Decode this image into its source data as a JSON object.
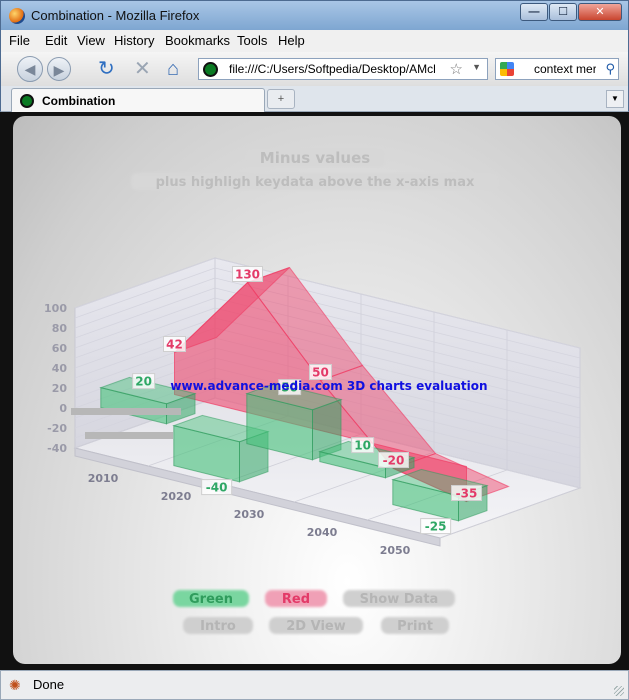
{
  "window": {
    "title": "Combination - Mozilla Firefox",
    "minimize": "—",
    "maximize": "☐",
    "close": "✕"
  },
  "menu": {
    "items": [
      "File",
      "Edit",
      "View",
      "History",
      "Bookmarks",
      "Tools",
      "Help"
    ]
  },
  "nav": {
    "url": "file:///C:/Users/Softpedia/Desktop/AMcl",
    "search_text": "context mer"
  },
  "tab": {
    "label": "Combination",
    "new_tab": "+"
  },
  "status": {
    "text": "Done"
  },
  "chart": {
    "title": "Minus values",
    "subtitle": "plus highligh keydata above the x-axis max",
    "watermark": "www.advance-media.com 3D charts evaluation",
    "buttons": {
      "green": "Green",
      "red": "Red",
      "show_data": "Show Data",
      "intro": "Intro",
      "view_2d": "2D View",
      "print": "Print"
    },
    "colors": {
      "green": "#44c27a",
      "red": "#f03c64",
      "watermark": "#1010e0"
    }
  },
  "chart_data": {
    "type": "bar",
    "categories": [
      "2010",
      "2020",
      "2030",
      "2040",
      "2050"
    ],
    "y_ticks": [
      "100",
      "80",
      "60",
      "40",
      "20",
      "0",
      "-20",
      "-40"
    ],
    "ylim": [
      -40,
      100
    ],
    "series": [
      {
        "name": "Green",
        "values": [
          20,
          -40,
          50,
          10,
          -25
        ],
        "render": "bar"
      },
      {
        "name": "Red",
        "values": [
          42,
          130,
          50,
          -20,
          -35
        ],
        "render": "area"
      }
    ],
    "grid": true
  }
}
